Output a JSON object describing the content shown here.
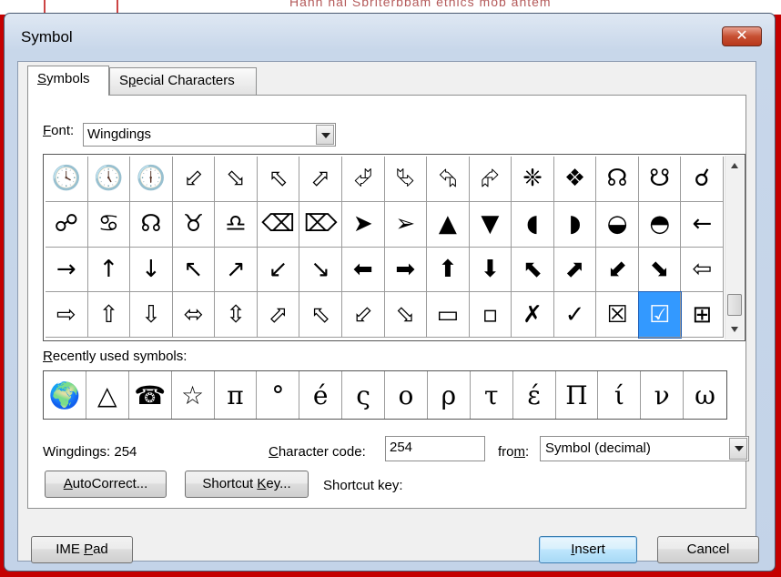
{
  "background_doc": {
    "text": "Hanh hai Sbriterbbam ethics mob ahtem"
  },
  "dialog": {
    "title": "Symbol",
    "close_glyph": "✕"
  },
  "tabs": [
    {
      "label": "Symbols",
      "accel": "S",
      "rest": "ymbols"
    },
    {
      "label": "Special Characters",
      "accel": "p",
      "pre": "S",
      "rest": "ecial Characters"
    }
  ],
  "font": {
    "label_accel": "F",
    "label_rest": "ont:",
    "value": "Wingdings"
  },
  "symbols": [
    [
      "🕓",
      "🕔",
      "🕕",
      "⬃",
      "⬂",
      "⬁",
      "⬀",
      "⮰",
      "⮱",
      "⮲",
      "⮳",
      "❈",
      "❖",
      "☊",
      "☋",
      "☌"
    ],
    [
      "☍",
      "♋",
      "☊",
      "♉",
      "♎",
      "⌫",
      "⌦",
      "➤",
      "➢",
      "▲",
      "▼",
      "◖",
      "◗",
      "◒",
      "◓",
      "←"
    ],
    [
      "→",
      "↑",
      "↓",
      "↖",
      "↗",
      "↙",
      "↘",
      "⬅",
      "➡",
      "⬆",
      "⬇",
      "⬉",
      "⬈",
      "⬋",
      "⬊",
      "⇦"
    ],
    [
      "⇨",
      "⇧",
      "⇩",
      "⬄",
      "⇳",
      "⬀",
      "⬁",
      "⬃",
      "⬂",
      "▭",
      "▫",
      "✗",
      "✓",
      "☒",
      "☑",
      "⊞"
    ]
  ],
  "selected_symbol": "☑",
  "recent": {
    "label_accel": "R",
    "label_rest": "ecently used symbols:",
    "symbols": [
      "🌍",
      "△",
      "☎",
      "☆",
      "π",
      "°",
      "é",
      "ς",
      "ο",
      "ρ",
      "τ",
      "έ",
      "Π",
      "ί",
      "ν",
      "ω"
    ]
  },
  "status": {
    "text": "Wingdings: 254"
  },
  "char_code": {
    "label_accel": "C",
    "label_rest": "haracter code:",
    "value": "254"
  },
  "from": {
    "label_pre": "fro",
    "label_accel": "m",
    "label_rest": ":",
    "value": "Symbol (decimal)"
  },
  "buttons": {
    "autocorrect": {
      "accel": "A",
      "rest": "utoCorrect..."
    },
    "shortcut_key": {
      "pre": "Shortcut ",
      "accel": "K",
      "rest": "ey..."
    },
    "ime_pad": {
      "pre": "IME ",
      "accel": "P",
      "rest": "ad"
    },
    "insert": {
      "accel": "I",
      "rest": "nsert"
    },
    "cancel": {
      "label": "Cancel"
    }
  },
  "shortcut_label": "Shortcut key:"
}
